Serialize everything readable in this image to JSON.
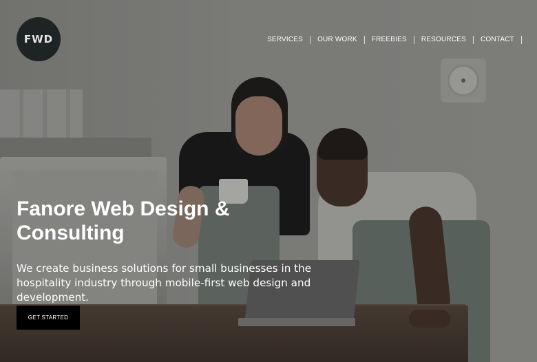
{
  "brand": {
    "logo_text": "FWD"
  },
  "nav": {
    "items": [
      {
        "label": "SERVICES"
      },
      {
        "label": "OUR WORK"
      },
      {
        "label": "FREEBIES"
      },
      {
        "label": "RESOURCES"
      },
      {
        "label": "CONTACT"
      }
    ]
  },
  "hero": {
    "title": "Fanore Web Design & Consulting",
    "subtitle": "We create business solutions for small businesses in the hospitality industry through mobile-first web design and development.",
    "cta_label": "GET STARTED"
  },
  "colors": {
    "cta_background": "#000000",
    "logo_background": "#1d2423",
    "text": "#ffffff"
  }
}
